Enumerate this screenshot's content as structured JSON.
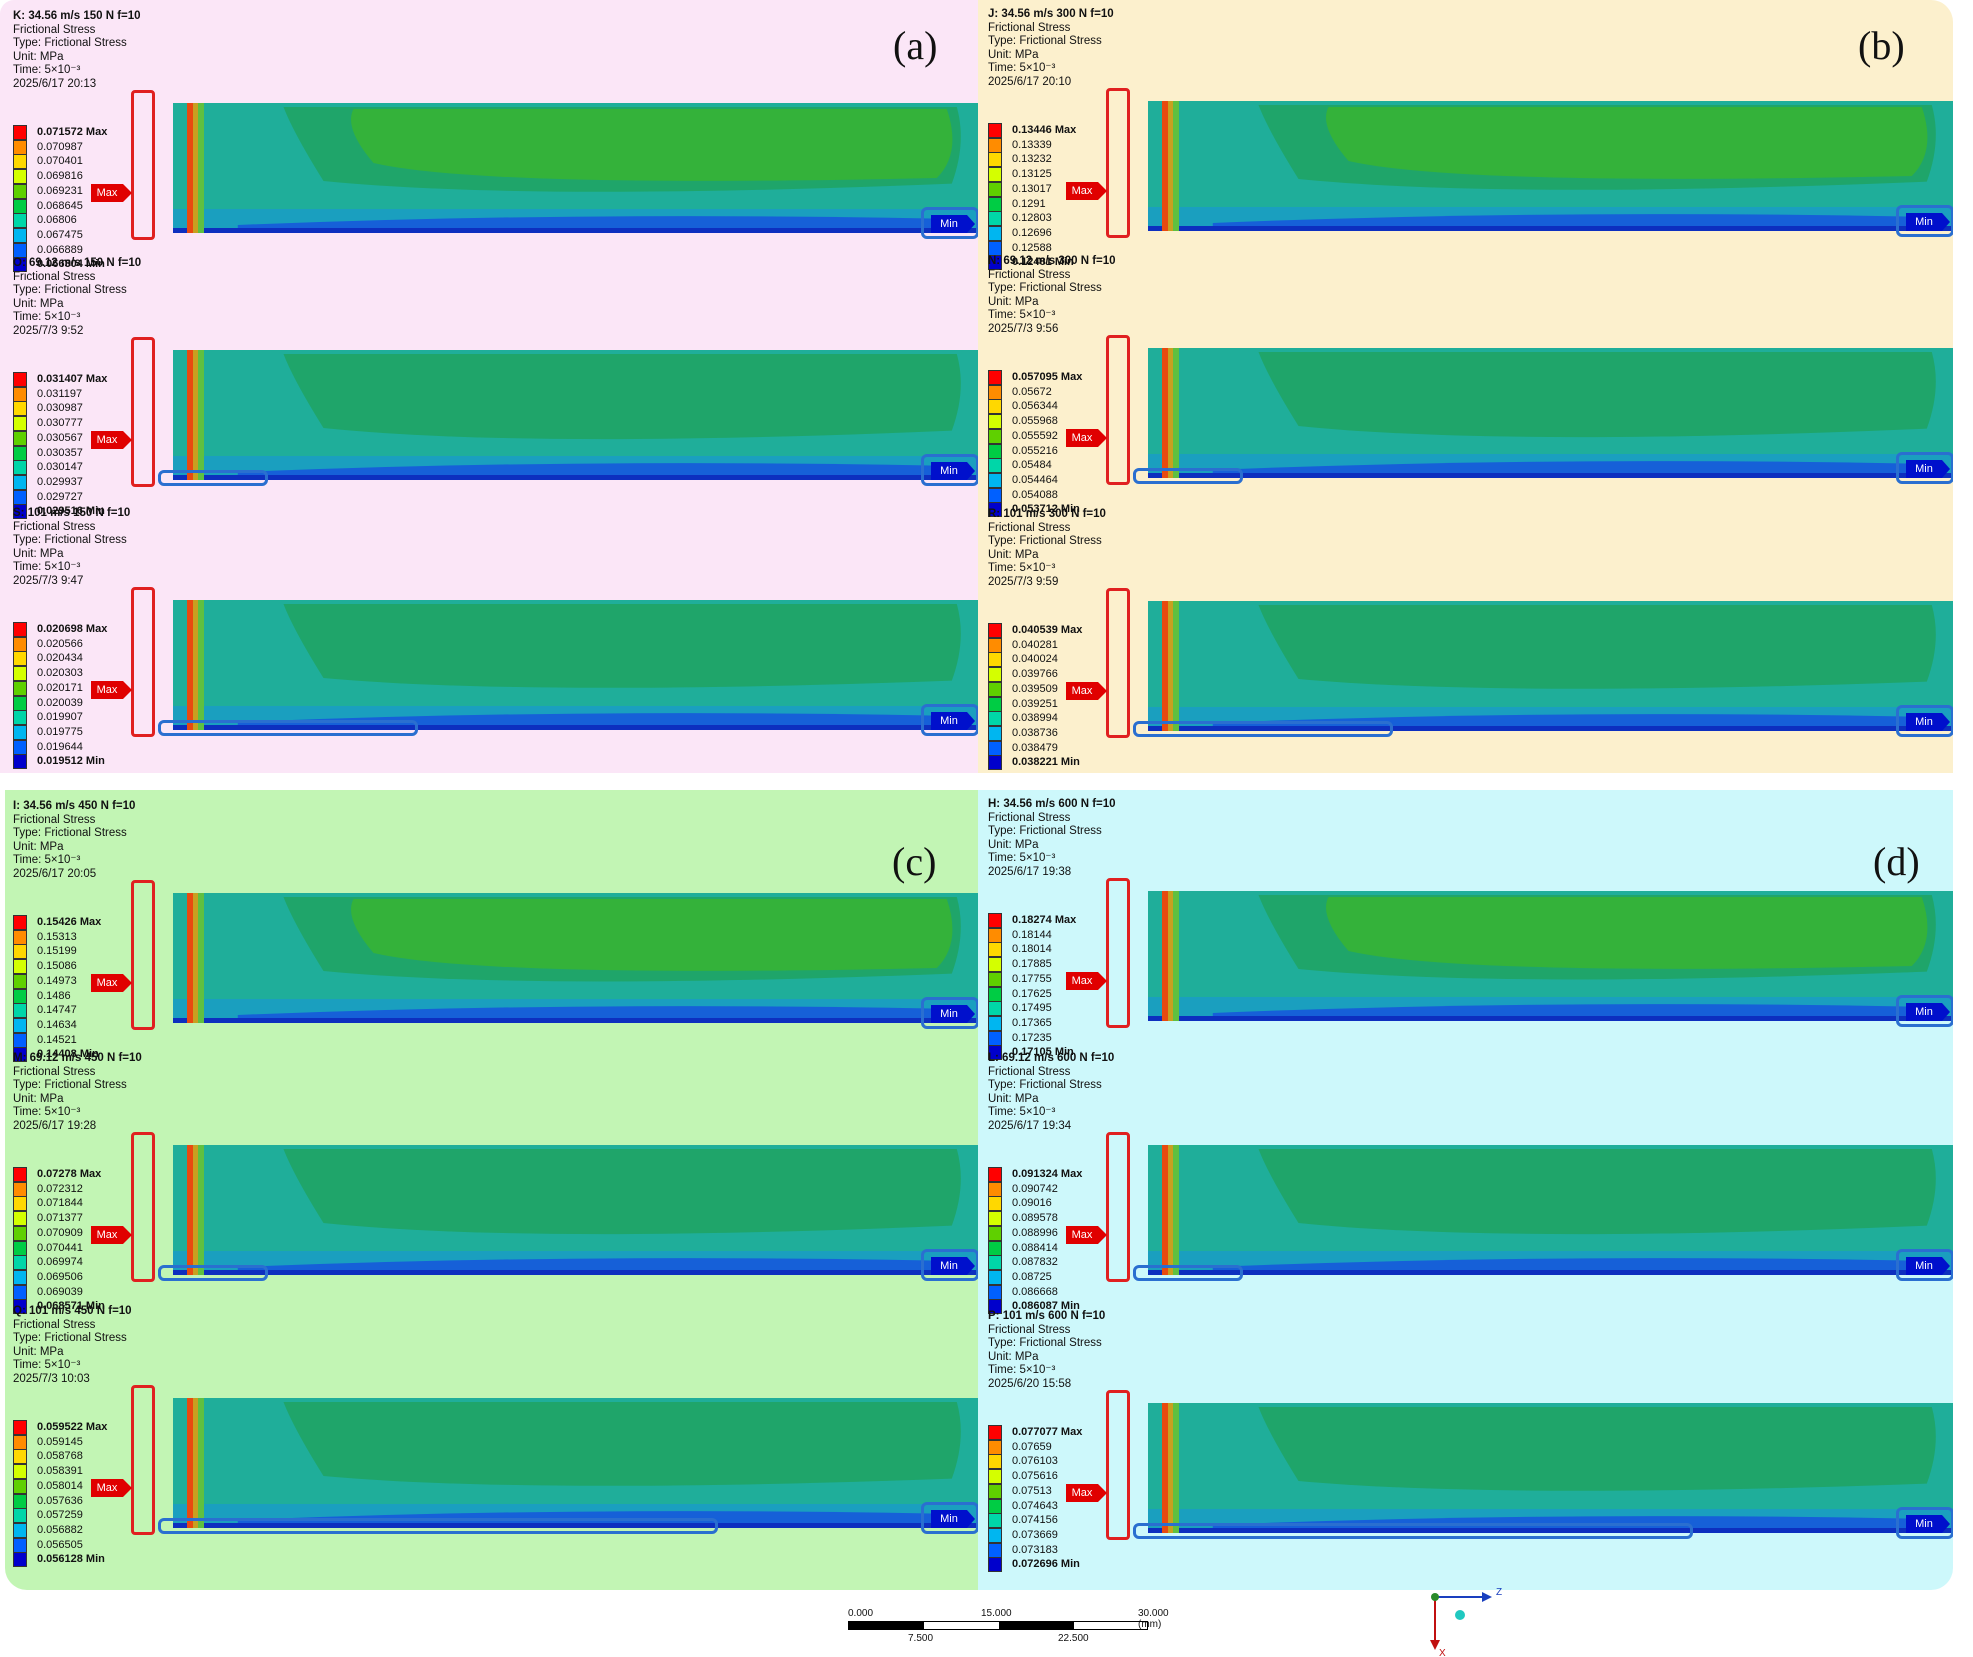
{
  "quadrants": [
    {
      "label": "(a)",
      "bg": "#fbe6f7",
      "panels": [
        {
          "title": "K: 34.56 m/s  150 N   f=10",
          "legend": [
            "0.071572 Max",
            "0.070987",
            "0.070401",
            "0.069816",
            "0.069231",
            "0.068645",
            "0.06806",
            "0.067475",
            "0.066889",
            "0.066304 Min"
          ],
          "date": "2025/6/17 20:13",
          "extend": 0.55
        },
        {
          "title": "O: 69.12 m/s  150 N   f=10",
          "legend": [
            "0.031407 Max",
            "0.031197",
            "0.030987",
            "0.030777",
            "0.030567",
            "0.030357",
            "0.030147",
            "0.029937",
            "0.029727",
            "0.029516 Min"
          ],
          "date": "2025/7/3 9:52",
          "extend": 0.6
        },
        {
          "title": "S: 101 m/s 150 N   f=10",
          "legend": [
            "0.020698 Max",
            "0.020566",
            "0.020434",
            "0.020303",
            "0.020171",
            "0.020039",
            "0.019907",
            "0.019775",
            "0.019644",
            "0.019512 Min"
          ],
          "date": "2025/7/3 9:47",
          "extend": 0.4
        }
      ]
    },
    {
      "label": "(b)",
      "bg": "#fcf0cd",
      "panels": [
        {
          "title": "J: 34.56 m/s  300 N   f=10",
          "legend": [
            "0.13446 Max",
            "0.13339",
            "0.13232",
            "0.13125",
            "0.13017",
            "0.1291",
            "0.12803",
            "0.12696",
            "0.12588",
            "0.12481 Min"
          ],
          "date": "2025/6/17 20:10",
          "extend": 0.55
        },
        {
          "title": "N: 69.12 m/s  300  N   f=10",
          "legend": [
            "0.057095 Max",
            "0.05672",
            "0.056344",
            "0.055968",
            "0.055592",
            "0.055216",
            "0.05484",
            "0.054464",
            "0.054088",
            "0.053712 Min"
          ],
          "date": "2025/7/3 9:56",
          "extend": 0.6
        },
        {
          "title": "R: 101 m/s 300 N    f=10",
          "legend": [
            "0.040539 Max",
            "0.040281",
            "0.040024",
            "0.039766",
            "0.039509",
            "0.039251",
            "0.038994",
            "0.038736",
            "0.038479",
            "0.038221 Min"
          ],
          "date": "2025/7/3 9:59",
          "extend": 0.4
        }
      ]
    },
    {
      "label": "(c)",
      "bg": "#c2f5b4",
      "panels": [
        {
          "title": "I: 34.56 m/s  450 N   f=10",
          "legend": [
            "0.15426 Max",
            "0.15313",
            "0.15199",
            "0.15086",
            "0.14973",
            "0.1486",
            "0.14747",
            "0.14634",
            "0.14521",
            "0.14408 Min"
          ],
          "date": "2025/6/17 20:05",
          "extend": 0.5
        },
        {
          "title": "M: 69.12 m/s  450  N    f=10",
          "legend": [
            "0.07278 Max",
            "0.072312",
            "0.071844",
            "0.071377",
            "0.070909",
            "0.070441",
            "0.069974",
            "0.069506",
            "0.069039",
            "0.068571 Min"
          ],
          "date": "2025/6/17 19:28",
          "extend": 0.6
        },
        {
          "title": "Q: 101 m/s  450  N   f=10",
          "legend": [
            "0.059522 Max",
            "0.059145",
            "0.058768",
            "0.058391",
            "0.058014",
            "0.057636",
            "0.057259",
            "0.056882",
            "0.056505",
            "0.056128 Min"
          ],
          "date": "2025/7/3 10:03",
          "extend": 0.4
        }
      ]
    },
    {
      "label": "(d)",
      "bg": "#cdf8fb",
      "panels": [
        {
          "title": "H: 34.56 m/s 600 N  f=10",
          "legend": [
            "0.18274 Max",
            "0.18144",
            "0.18014",
            "0.17885",
            "0.17755",
            "0.17625",
            "0.17495",
            "0.17365",
            "0.17235",
            "0.17105 Min"
          ],
          "date": "2025/6/17 19:38",
          "extend": 0.5
        },
        {
          "title": "L: 69.12 m/s  600 N    f=10",
          "legend": [
            "0.091324 Max",
            "0.090742",
            "0.09016",
            "0.089578",
            "0.088996",
            "0.088414",
            "0.087832",
            "0.08725",
            "0.086668",
            "0.086087 Min"
          ],
          "date": "2025/6/17 19:34",
          "extend": 0.6
        },
        {
          "title": "P: 101 m/s  600  N    f=10",
          "legend": [
            "0.077077 Max",
            "0.07659",
            "0.076103",
            "0.075616",
            "0.07513",
            "0.074643",
            "0.074156",
            "0.073669",
            "0.073183",
            "0.072696 Min"
          ],
          "date": "2025/6/20 15:58",
          "extend": 0.4
        }
      ]
    }
  ],
  "common": {
    "line2": "Frictional Stress",
    "line3": "Type: Frictional Stress",
    "line4": "Unit: MPa",
    "line5": "Time: 5×10⁻³",
    "max_tag": "Max",
    "min_tag": "Min"
  },
  "legend_colors": [
    "#ff0000",
    "#ff8c00",
    "#ffd800",
    "#d4ff00",
    "#5fd000",
    "#00cc44",
    "#00d6a8",
    "#00b6f0",
    "#0060ff",
    "#0000cc"
  ],
  "scale": {
    "ticks_top": [
      "0.000",
      "15.000",
      "30.000 (mm)"
    ],
    "ticks_bottom": [
      "7.500",
      "22.500"
    ]
  },
  "axes": {
    "z": "Z",
    "x": "X"
  }
}
